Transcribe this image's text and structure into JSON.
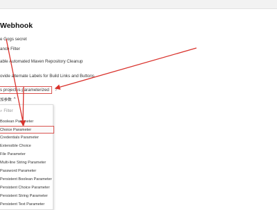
{
  "section_title": "Webhook",
  "options": [
    "e Gogs secret",
    "anch Filter",
    "able Automated Maven Repository Cleanup",
    "ovide alternate Labels for Build Links and Buttons"
  ],
  "parameterized": {
    "label": "s project is parameterized",
    "help": "?"
  },
  "add_param": {
    "label": "加参数",
    "chevron": "^"
  },
  "dropdown": {
    "filter_placeholder": "Filter",
    "items": [
      "Boolean Parameter",
      "Choice Parameter",
      "Credentials Parameter",
      "Extensible Choice",
      "File Parameter",
      "Multi-line String Parameter",
      "Password Parameter",
      "Persistent Boolean Parameter",
      "Persistent Choice Parameter",
      "Persistent String Parameter",
      "Persistent Text Parameter"
    ],
    "highlighted_index": 1
  },
  "colors": {
    "annotation": "#d9312b"
  }
}
